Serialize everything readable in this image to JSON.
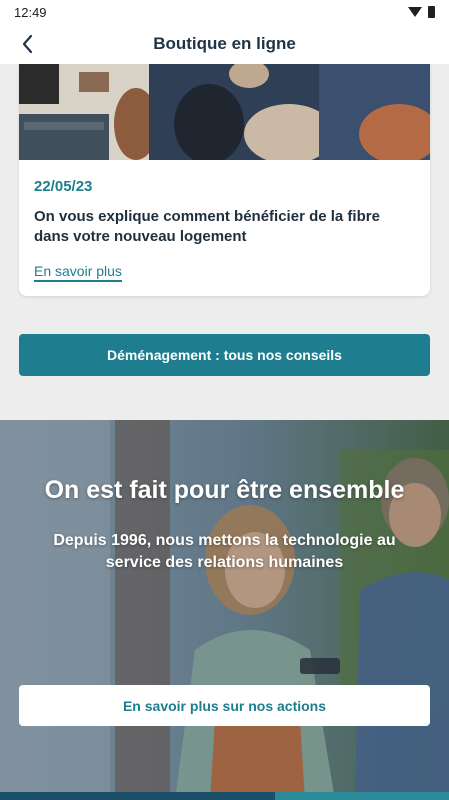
{
  "status_bar": {
    "time": "12:49",
    "icons": [
      "wifi-icon",
      "battery-icon"
    ]
  },
  "app_bar": {
    "title": "Boutique en ligne",
    "back_icon": "chevron-left-icon"
  },
  "article_card": {
    "date": "22/05/23",
    "title": "On vous explique comment bénéficier de la fibre dans votre nouveau logement",
    "link_label": "En savoir plus"
  },
  "moving_button": {
    "label": "Déménagement : tous nos conseils"
  },
  "hero": {
    "heading": "On est fait pour être ensemble",
    "subtext": "Depuis 1996, nous mettons la technologie au service des relations humaines",
    "button_label": "En savoir plus sur nos actions"
  },
  "colors": {
    "accent": "#1e7d8f",
    "title": "#1f3447",
    "background": "#ededed"
  }
}
